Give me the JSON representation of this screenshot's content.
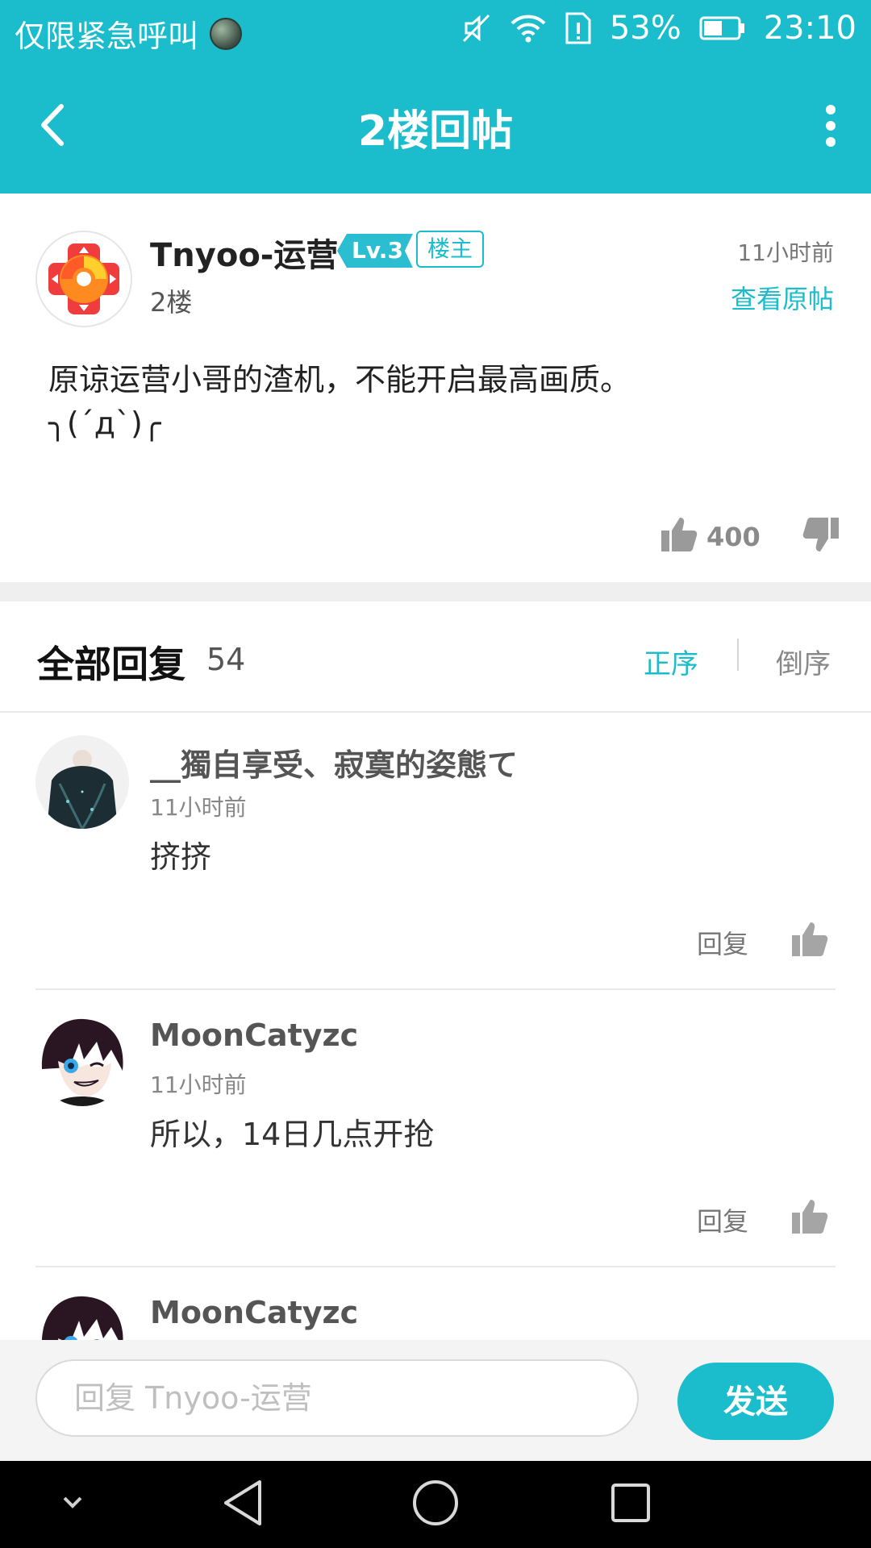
{
  "status_bar": {
    "carrier": "仅限紧急呼叫",
    "battery": "53%",
    "time": "23:10"
  },
  "titlebar": {
    "title": "2楼回帖"
  },
  "post": {
    "author": "Tnyoo-运营",
    "level": "Lv.3",
    "owner_badge": "楼主",
    "floor": "2楼",
    "time": "11小时前",
    "view_original": "查看原帖",
    "content_line1": "原谅运营小哥的渣机，不能开启最高画质。",
    "content_line2": "╮(´д`)╭",
    "likes": "400"
  },
  "replies_header": {
    "title": "全部回复",
    "count": "54",
    "sort_asc": "正序",
    "sort_desc": "倒序"
  },
  "replies": [
    {
      "name": "__獨自享受、寂寞的姿態て",
      "time": "11小时前",
      "text": "挤挤",
      "reply_label": "回复"
    },
    {
      "name": "MoonCatyzc",
      "time": "11小时前",
      "text": "所以，14日几点开抢",
      "reply_label": "回复"
    },
    {
      "name": "MoonCatyzc",
      "time": "",
      "text": "",
      "reply_label": ""
    }
  ],
  "input_bar": {
    "placeholder": "回复 Tnyoo-运营",
    "send_label": "发送"
  },
  "colors": {
    "accent": "#1bbccb",
    "background": "#ffffff"
  }
}
